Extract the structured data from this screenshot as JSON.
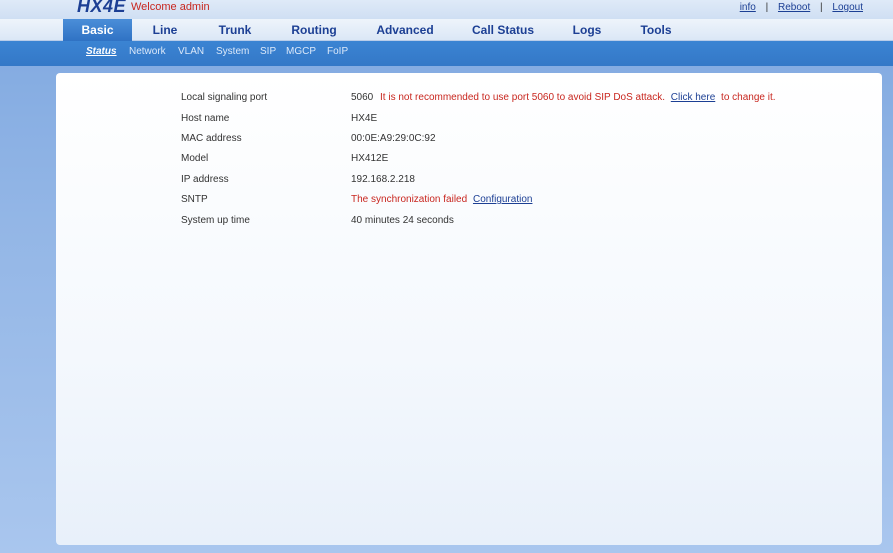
{
  "header": {
    "logo": "HX4E",
    "welcome": "Welcome admin",
    "links": {
      "info": "info",
      "reboot": "Reboot",
      "logout": "Logout",
      "separator": "|"
    }
  },
  "nav": {
    "tabs": [
      "Basic",
      "Line",
      "Trunk",
      "Routing",
      "Advanced",
      "Call Status",
      "Logs",
      "Tools"
    ],
    "active": "Basic"
  },
  "subnav": {
    "items": [
      "Status",
      "Network",
      "VLAN",
      "System",
      "SIP",
      "MGCP",
      "FoIP"
    ],
    "active": "Status"
  },
  "status": {
    "local_signaling_port": {
      "label": "Local signaling port",
      "value": "5060",
      "warning": "It is not recommended to use port 5060 to avoid SIP DoS attack.",
      "link": "Click here",
      "suffix": "to change it."
    },
    "host_name": {
      "label": "Host name",
      "value": "HX4E"
    },
    "mac_address": {
      "label": "MAC address",
      "value": "00:0E:A9:29:0C:92"
    },
    "model": {
      "label": "Model",
      "value": "HX412E"
    },
    "ip_address": {
      "label": "IP address",
      "value": "192.168.2.218"
    },
    "sntp": {
      "label": "SNTP",
      "warning": "The synchronization failed",
      "link": "Configuration"
    },
    "uptime": {
      "label": "System up time",
      "value": "40 minutes 24 seconds"
    }
  },
  "colors": {
    "accent": "#2f72c4",
    "warning": "#c8261f",
    "link": "#1c3f94"
  }
}
